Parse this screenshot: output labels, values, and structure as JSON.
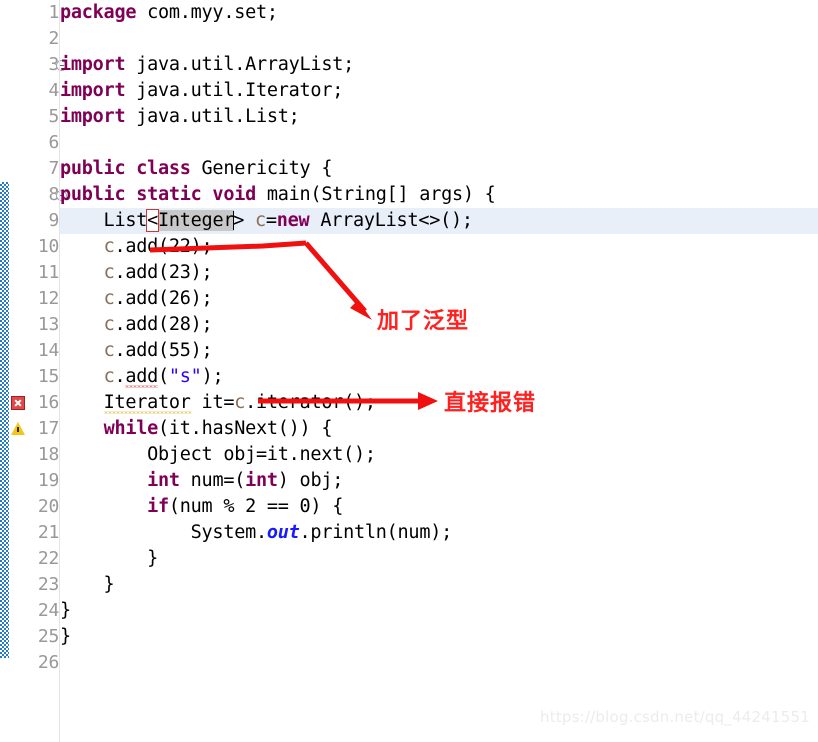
{
  "editor": {
    "watermark": "https://blog.csdn.net/qq_44241551",
    "current_line": 9,
    "total_lines": 26,
    "colors": {
      "keyword": "#7f0055",
      "string": "#2a00ff",
      "field": "#8a6f5a",
      "static_field": "#1a1aff",
      "current_line_highlight": "#e8eff9",
      "selection": "#c8c8c8",
      "annotation_red": "#ff2020",
      "change_bar": "#1b74c4",
      "error_marker": "#e04a4a",
      "warning_marker": "#f5c518",
      "line_number": "#999999"
    },
    "lines": [
      {
        "n": "1",
        "code": "package com.myy.set;"
      },
      {
        "n": "2",
        "code": ""
      },
      {
        "n": "3",
        "code": "import java.util.ArrayList;"
      },
      {
        "n": "4",
        "code": "import java.util.Iterator;"
      },
      {
        "n": "5",
        "code": "import java.util.List;"
      },
      {
        "n": "6",
        "code": ""
      },
      {
        "n": "7",
        "code": "public class Genericity {"
      },
      {
        "n": "8",
        "code": "public static void main(String[] args) {"
      },
      {
        "n": "9",
        "code": "    List<Integer> c=new ArrayList<>();"
      },
      {
        "n": "10",
        "code": "    c.add(22);"
      },
      {
        "n": "11",
        "code": "    c.add(23);"
      },
      {
        "n": "12",
        "code": "    c.add(26);"
      },
      {
        "n": "13",
        "code": "    c.add(28);"
      },
      {
        "n": "14",
        "code": "    c.add(55);"
      },
      {
        "n": "15",
        "code": "    c.add(\"s\");"
      },
      {
        "n": "16",
        "code": "    Iterator it=c.iterator();"
      },
      {
        "n": "17",
        "code": "    while(it.hasNext()) {"
      },
      {
        "n": "18",
        "code": "        Object obj=it.next();"
      },
      {
        "n": "19",
        "code": "        int num=(int) obj;"
      },
      {
        "n": "20",
        "code": "        if(num % 2 == 0) {"
      },
      {
        "n": "21",
        "code": "            System.out.println(num);"
      },
      {
        "n": "22",
        "code": "        }"
      },
      {
        "n": "23",
        "code": "    }"
      },
      {
        "n": "24",
        "code": "}"
      },
      {
        "n": "25",
        "code": "}"
      },
      {
        "n": "26",
        "code": ""
      }
    ],
    "markers": [
      {
        "line": "3",
        "type": "fold-collapse-icon"
      },
      {
        "line": "8",
        "type": "fold-collapse-icon"
      },
      {
        "line": "15",
        "type": "error-marker-icon"
      },
      {
        "line": "16",
        "type": "warning-marker-icon"
      }
    ],
    "selection": {
      "line": "9",
      "text": "<Integer"
    }
  },
  "annotations": [
    {
      "id": "a1",
      "text": "加了泛型",
      "arrow": "bent-down-right"
    },
    {
      "id": "a2",
      "text": "直接报错",
      "arrow": "straight-right"
    }
  ]
}
